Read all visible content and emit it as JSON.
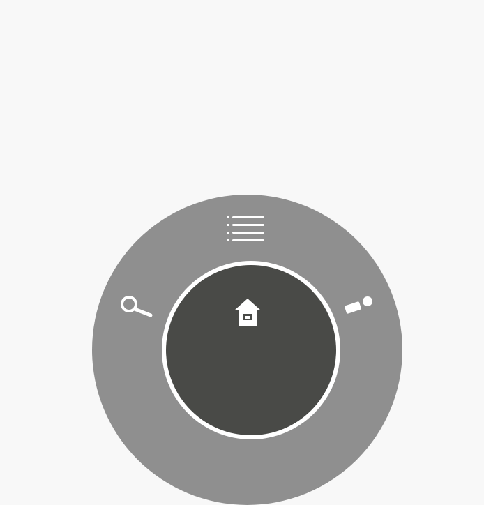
{
  "ui": {
    "background_color": "#f8f8f8",
    "outer_ring_color": "#8f8f8f",
    "center_color": "#494a47",
    "icon_color": "#ffffff",
    "icons": {
      "menu": "menu-icon",
      "search": "search-icon",
      "info": "info-icon",
      "home": "home-icon"
    }
  }
}
